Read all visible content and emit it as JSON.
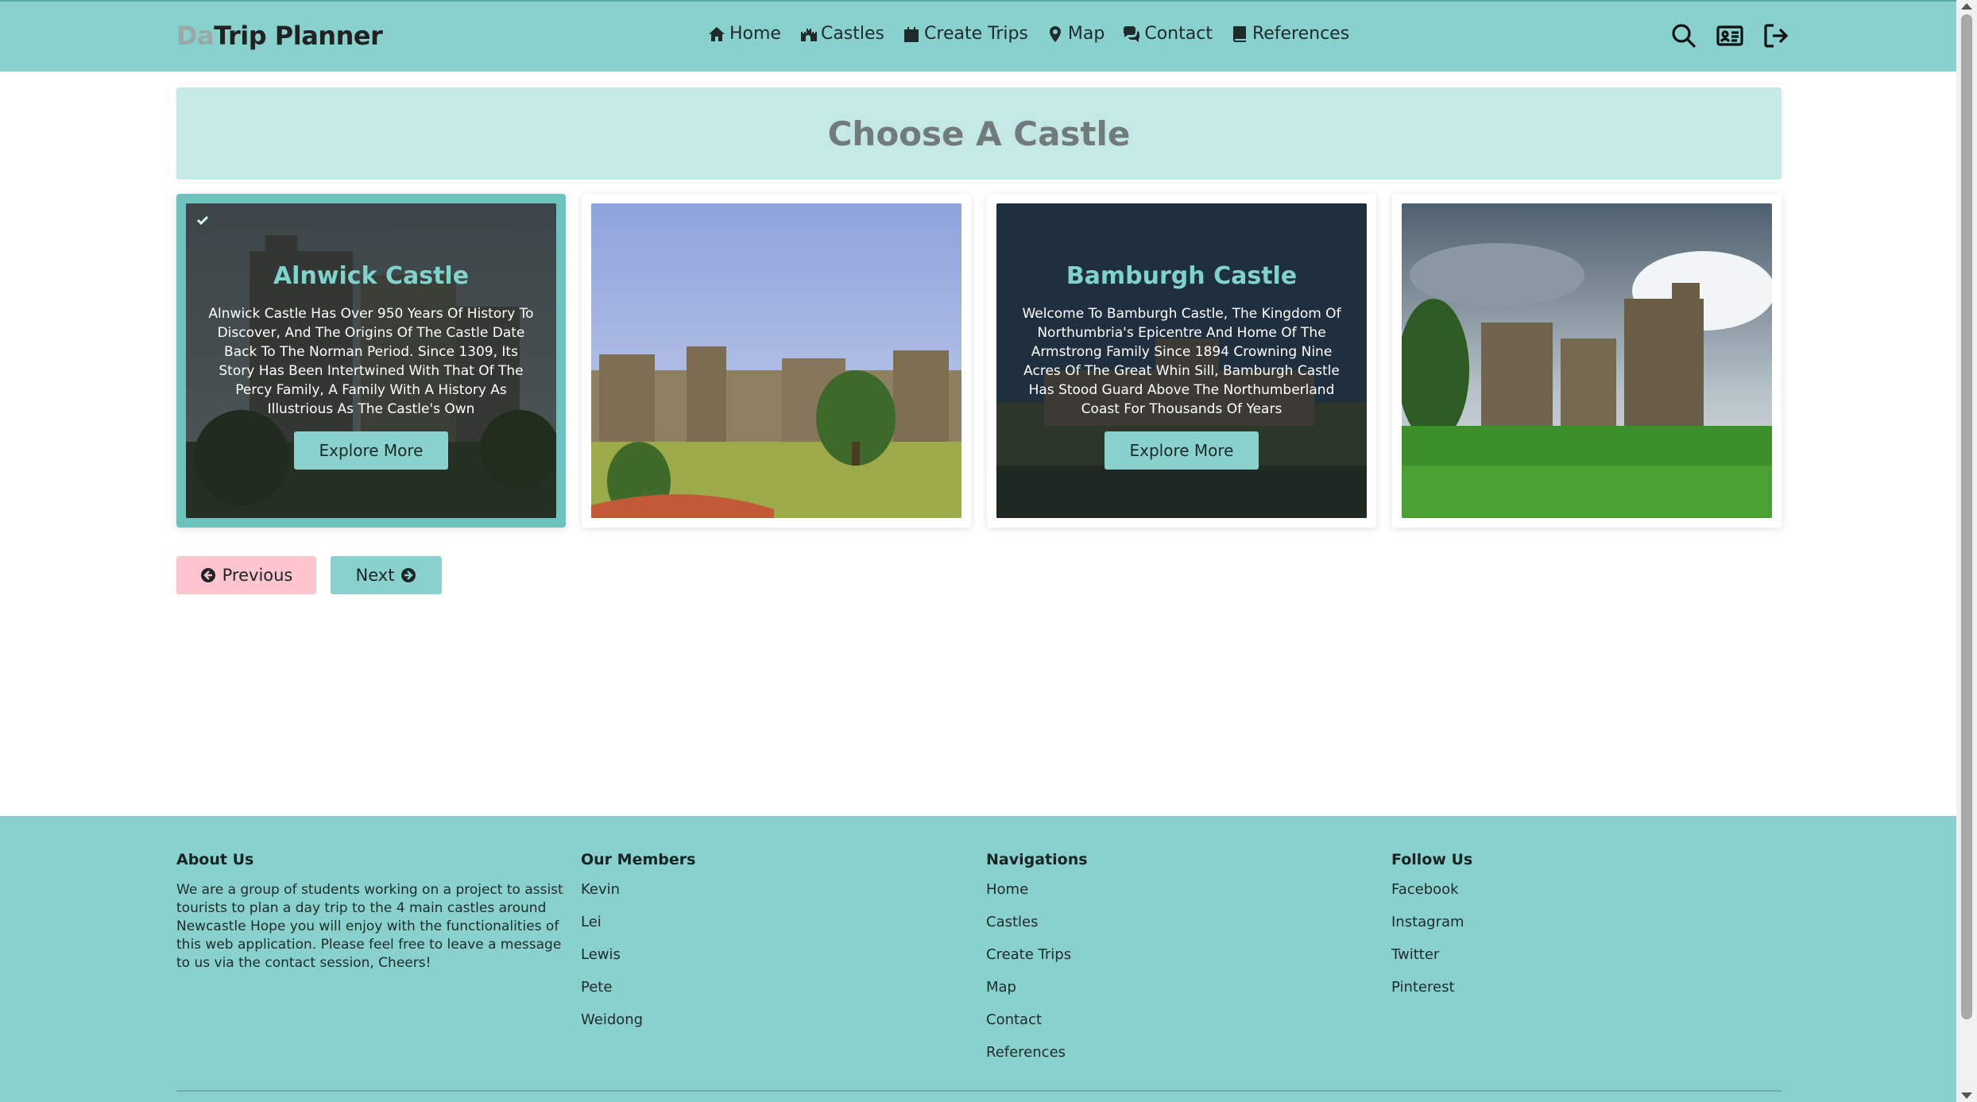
{
  "navbar": {
    "brand_prefix": "Da",
    "brand_main": "Trip Planner",
    "links": [
      {
        "label": "Home",
        "icon": "home-icon"
      },
      {
        "label": "Castles",
        "icon": "castle-icon"
      },
      {
        "label": "Create Trips",
        "icon": "calendar-icon"
      },
      {
        "label": "Map",
        "icon": "map-pin-icon"
      },
      {
        "label": "Contact",
        "icon": "chat-icon"
      },
      {
        "label": "References",
        "icon": "book-icon"
      }
    ],
    "right_icons": [
      "search-icon",
      "id-card-icon",
      "logout-icon"
    ]
  },
  "banner": {
    "title": "Choose A Castle"
  },
  "cards": [
    {
      "title": "Alnwick Castle",
      "description": "Alnwick Castle Has Over 950 Years Of History To Discover, And The Origins Of The Castle Date Back To The Norman Period. Since 1309, Its Story Has Been Intertwined With That Of The Percy Family, A Family With A History As Illustrious As The Castle's Own",
      "button": "Explore More",
      "selected": true,
      "overlay": true
    },
    {
      "title": "",
      "description": "",
      "button": "",
      "selected": false,
      "overlay": false
    },
    {
      "title": "Bamburgh Castle",
      "description": "Welcome To Bamburgh Castle, The Kingdom Of Northumbria's Epicentre And Home Of The Armstrong Family Since 1894 Crowning Nine Acres Of The Great Whin Sill, Bamburgh Castle Has Stood Guard Above The Northumberland Coast For Thousands Of Years",
      "button": "Explore More",
      "selected": false,
      "overlay": true
    },
    {
      "title": "",
      "description": "",
      "button": "",
      "selected": false,
      "overlay": false
    }
  ],
  "pager": {
    "previous": "Previous",
    "next": "Next"
  },
  "footer": {
    "about": {
      "heading": "About Us",
      "text": "We are a group of students working on a project to assist tourists to plan a day trip to the 4 main castles around Newcastle Hope you will enjoy with the functionalities of this web application. Please feel free to leave a message to us via the contact session, Cheers!"
    },
    "members": {
      "heading": "Our Members",
      "items": [
        "Kevin",
        "Lei",
        "Lewis",
        "Pete",
        "Weidong"
      ]
    },
    "navigations": {
      "heading": "Navigations",
      "items": [
        "Home",
        "Castles",
        "Create Trips",
        "Map",
        "Contact",
        "References"
      ]
    },
    "follow": {
      "heading": "Follow Us",
      "items": [
        "Facebook",
        "Instagram",
        "Twitter",
        "Pinterest"
      ]
    }
  },
  "colors": {
    "nav_bg": "#88d1cc",
    "banner_bg": "#c3e8e5",
    "card_title": "#7fd3cd",
    "prev_button": "#ffc5cf",
    "next_button": "#88d1cc"
  }
}
